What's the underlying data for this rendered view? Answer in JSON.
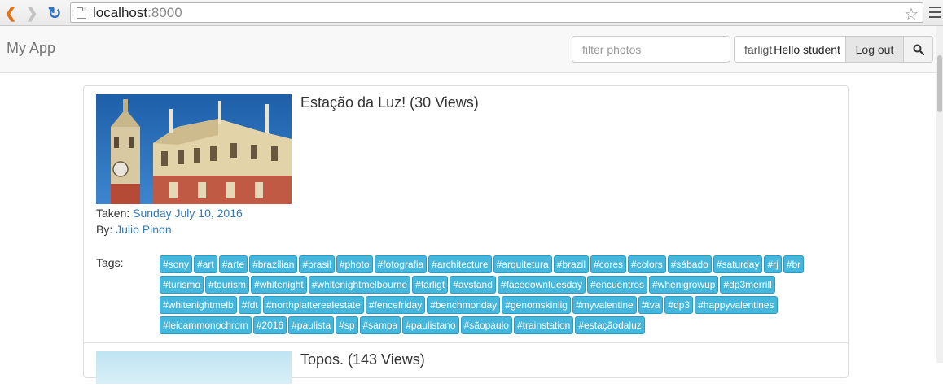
{
  "browser": {
    "url_host": "localhost",
    "url_port": ":8000"
  },
  "navbar": {
    "brand": "My App",
    "filter_placeholder": "filter photos",
    "search_value": "farligt",
    "greeting": "Hello student",
    "logout_label": "Log out"
  },
  "photos": [
    {
      "title": "Estação da Luz! (30 Views)",
      "taken_label": "Taken:",
      "taken_date": "Sunday July 10, 2016",
      "by_label": "By:",
      "author": "Julio Pinon",
      "tags_label": "Tags:",
      "tags": [
        "#sony",
        "#art",
        "#arte",
        "#brazilian",
        "#brasil",
        "#photo",
        "#fotografia",
        "#architecture",
        "#arquitetura",
        "#brazil",
        "#cores",
        "#colors",
        "#sábado",
        "#saturday",
        "#rj",
        "#br",
        "#turismo",
        "#tourism",
        "#whitenight",
        "#whitenightmelbourne",
        "#farligt",
        "#avstand",
        "#facedowntuesday",
        "#encuentros",
        "#whenigrowup",
        "#dp3merrill",
        "#whitenightmelb",
        "#fdt",
        "#northplatterealestate",
        "#fencefriday",
        "#benchmonday",
        "#genomskinlig",
        "#myvalentine",
        "#tva",
        "#dp3",
        "#happyvalentines",
        "#leicammonochrom",
        "#2016",
        "#paulista",
        "#sp",
        "#sampa",
        "#paulistano",
        "#sãopaulo",
        "#trainstation",
        "#estaçãodaluz"
      ]
    },
    {
      "title": "Topos. (143 Views)"
    }
  ],
  "colors": {
    "tag_bg": "#45b6dc",
    "link": "#337ab7",
    "navbar_bg": "#f8f8f8"
  },
  "icons": {
    "back": "back-arrow-icon",
    "forward": "forward-arrow-icon",
    "reload": "reload-icon",
    "bookmark": "star-icon",
    "menu": "hamburger-menu-icon",
    "search": "search-icon"
  }
}
